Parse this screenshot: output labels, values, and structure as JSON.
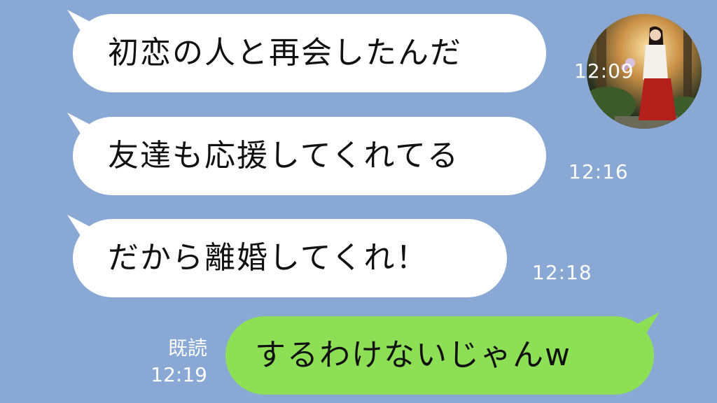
{
  "messages": [
    {
      "text": "初恋の人と再会したんだ",
      "time": "12:09",
      "side": "received"
    },
    {
      "text": "友達も応援してくれてる",
      "time": "12:16",
      "side": "received"
    },
    {
      "text": "だから離婚してくれ！",
      "time": "12:18",
      "side": "received"
    },
    {
      "text": "するわけないじゃんw",
      "time": "12:19",
      "side": "sent",
      "read_label": "既読"
    }
  ],
  "colors": {
    "background": "#8aa8d4",
    "received_bubble": "#ffffff",
    "sent_bubble": "#8de055"
  },
  "icons": {
    "avatar": "avatar-shrine-maiden"
  }
}
